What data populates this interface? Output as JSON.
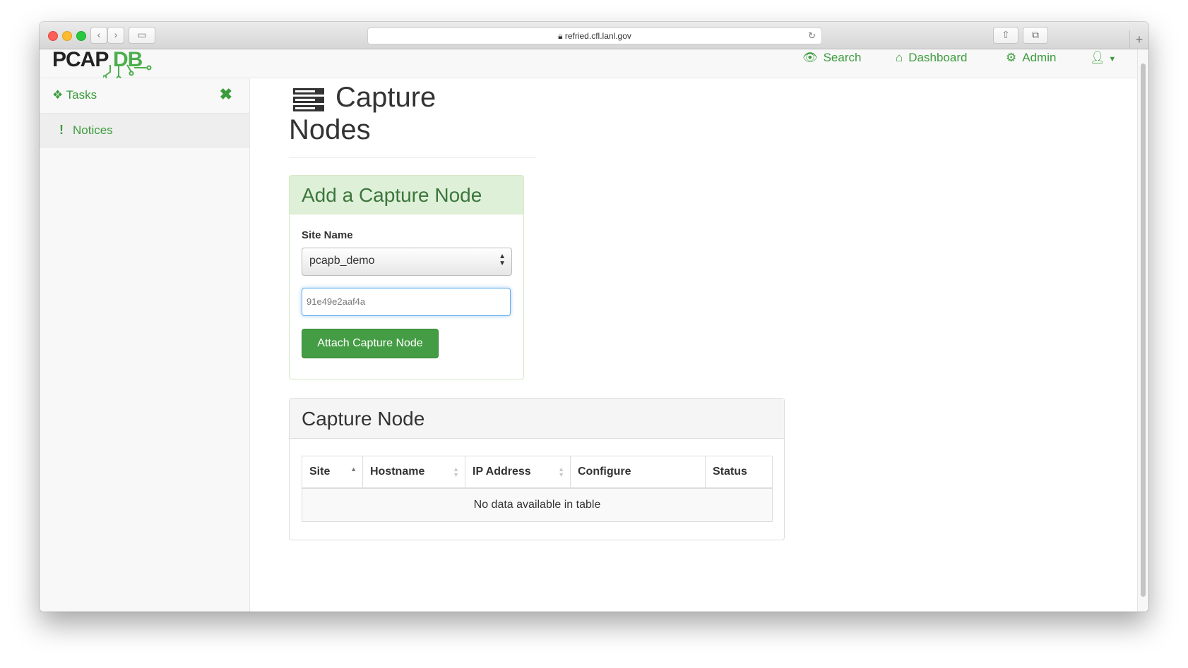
{
  "browser": {
    "url": "refried.cfl.lanl.gov"
  },
  "navbar": {
    "logo_part1": "PCAP",
    "logo_part2": "DB",
    "search_label": "Search",
    "dashboard_label": "Dashboard",
    "admin_label": "Admin"
  },
  "sidebar": {
    "tasks_label": "Tasks",
    "notices_label": "Notices"
  },
  "page": {
    "title_line1": "Capture",
    "title_line2": "Nodes"
  },
  "add_panel": {
    "heading": "Add a Capture Node",
    "site_label": "Site Name",
    "site_selected": "pcapb_demo",
    "node_input_value": "91e49e2aaf4a",
    "attach_button": "Attach Capture Node"
  },
  "list_panel": {
    "heading": "Capture Node",
    "columns": [
      "Site",
      "Hostname",
      "IP Address",
      "Configure",
      "Status"
    ],
    "empty_message": "No data available in table"
  },
  "colors": {
    "brand_green": "#3c9c3c",
    "button_green": "#449d44",
    "panel_success_bg": "#dff0d8"
  }
}
